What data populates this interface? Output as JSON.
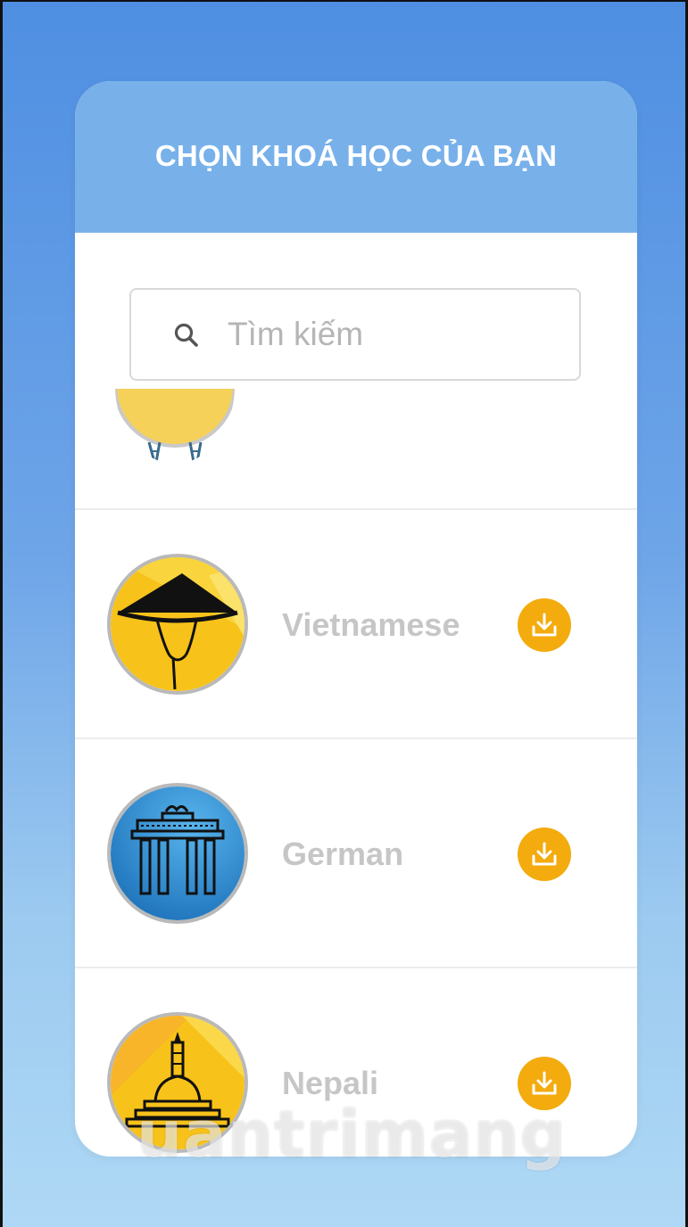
{
  "header": {
    "title": "CHỌN KHOÁ HỌC CỦA BẠN"
  },
  "search": {
    "placeholder": "Tìm kiếm",
    "value": ""
  },
  "courses": [
    {
      "name": "Vietnamese",
      "icon": "conical-hat-icon",
      "badge_color": "#f7c21a"
    },
    {
      "name": "German",
      "icon": "brandenburg-gate-icon",
      "badge_color": "#2e8ed8"
    },
    {
      "name": "Nepali",
      "icon": "stupa-icon",
      "badge_color": "#f7c21a"
    }
  ],
  "colors": {
    "header_bg": "#78b1ea",
    "download_button": "#f3ab0e",
    "course_name_text": "#c6c6c6"
  },
  "watermark": {
    "text": "uantrimang"
  }
}
